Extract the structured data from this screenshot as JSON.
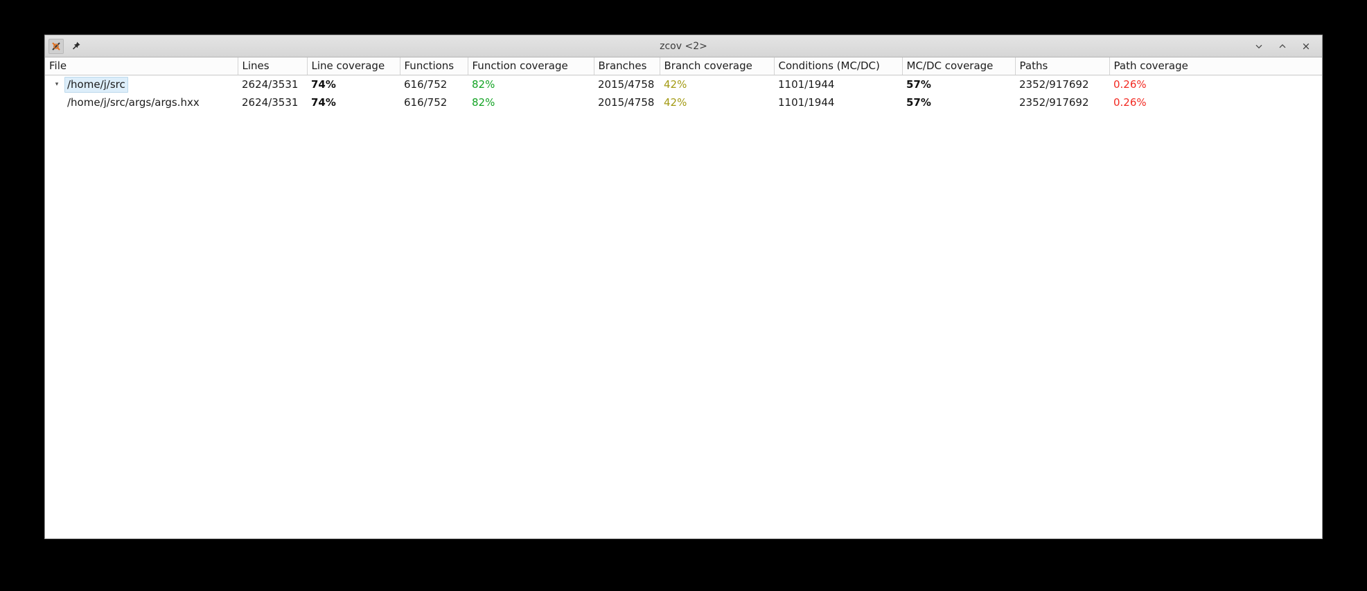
{
  "window": {
    "title": "zcov <2>",
    "titlebar_icons": [
      {
        "name": "x-app-icon",
        "glyph": "X"
      },
      {
        "name": "pin-icon",
        "glyph": "pin"
      }
    ],
    "controls": [
      {
        "name": "minimize-button",
        "label": "⌄"
      },
      {
        "name": "maximize-button",
        "label": "⌃"
      },
      {
        "name": "close-button",
        "label": "✕"
      }
    ]
  },
  "table": {
    "columns": [
      {
        "key": "file",
        "label": "File"
      },
      {
        "key": "lines",
        "label": "Lines"
      },
      {
        "key": "line_coverage",
        "label": "Line coverage"
      },
      {
        "key": "functions",
        "label": "Functions"
      },
      {
        "key": "function_coverage",
        "label": "Function coverage"
      },
      {
        "key": "branches",
        "label": "Branches"
      },
      {
        "key": "branch_coverage",
        "label": "Branch coverage"
      },
      {
        "key": "conditions",
        "label": "Conditions (MC/DC)"
      },
      {
        "key": "mcdc_coverage",
        "label": "MC/DC coverage"
      },
      {
        "key": "paths",
        "label": "Paths"
      },
      {
        "key": "path_coverage",
        "label": "Path coverage"
      }
    ],
    "rows": [
      {
        "expander": "▾",
        "selected": true,
        "indent": 0,
        "file": "/home/j/src",
        "lines": "2624/3531",
        "line_coverage": "74%",
        "functions": "616/752",
        "function_coverage": "82%",
        "branches": "2015/4758",
        "branch_coverage": "42%",
        "conditions": "1101/1944",
        "mcdc_coverage": "57%",
        "paths": "2352/917692",
        "path_coverage": "0.26%"
      },
      {
        "expander": "",
        "selected": false,
        "indent": 1,
        "file": "/home/j/src/args/args.hxx",
        "lines": "2624/3531",
        "line_coverage": "74%",
        "functions": "616/752",
        "function_coverage": "82%",
        "branches": "2015/4758",
        "branch_coverage": "42%",
        "conditions": "1101/1944",
        "mcdc_coverage": "57%",
        "paths": "2352/917692",
        "path_coverage": "0.26%"
      }
    ]
  },
  "colors": {
    "good": "#13a324",
    "warn": "#a39a13",
    "bad": "#f22a22",
    "selection": "#ddeefa"
  }
}
